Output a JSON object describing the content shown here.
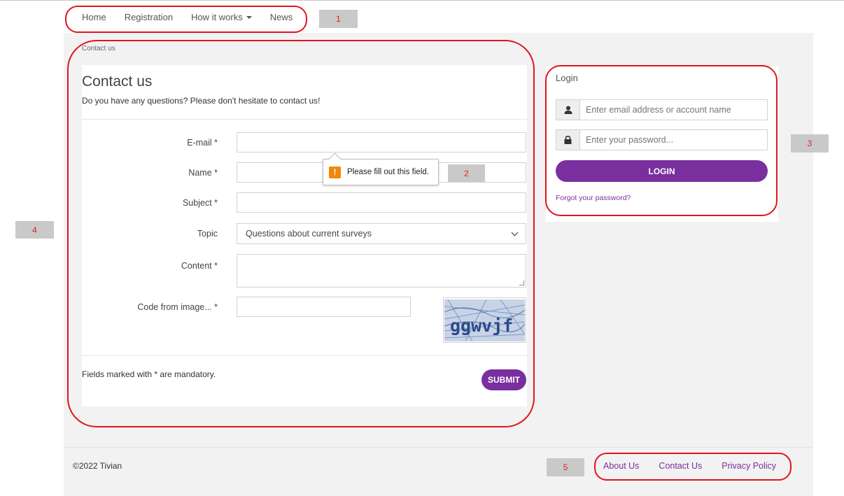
{
  "nav": {
    "items": [
      "Home",
      "Registration",
      "How it works",
      "News"
    ]
  },
  "annotations": [
    "1",
    "2",
    "3",
    "4",
    "5"
  ],
  "breadcrumb": "Contact us",
  "contact": {
    "title": "Contact us",
    "subtitle": "Do you have any questions? Please don't hesitate to contact us!",
    "labels": {
      "email": "E-mail *",
      "name": "Name *",
      "subject": "Subject *",
      "topic": "Topic",
      "content": "Content *",
      "code": "Code from image... *"
    },
    "topic_selected": "Questions about current surveys",
    "tooltip": "Please fill out this field.",
    "captcha_text": "ggwvjf",
    "mandatory_note": "Fields marked with * are mandatory.",
    "submit_label": "SUBMIT"
  },
  "login": {
    "title": "Login",
    "email_placeholder": "Enter email address or account name",
    "password_placeholder": "Enter your password...",
    "button_label": "LOGIN",
    "forgot_label": "Forgot your password?"
  },
  "footer": {
    "copyright": "©2022 Tivian",
    "links": [
      "About Us",
      "Contact Us",
      "Privacy Policy"
    ]
  },
  "colors": {
    "accent": "#7a2f9e",
    "annotation_ring": "#e0141e",
    "warning": "#f0880a"
  }
}
